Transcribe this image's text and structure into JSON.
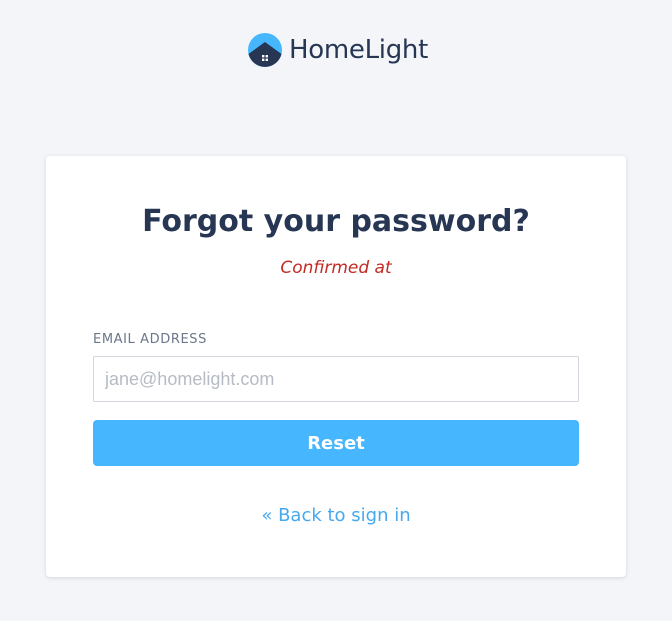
{
  "brand": {
    "name": "HomeLight",
    "logo_icon": "house-icon",
    "colors": {
      "logo_blue": "#46b6ff",
      "logo_navy": "#273653"
    }
  },
  "form": {
    "title": "Forgot your password?",
    "flash_message": "Confirmed at",
    "email_label": "EMAIL ADDRESS",
    "email_placeholder": "jane@homelight.com",
    "email_value": "",
    "submit_label": "Reset",
    "back_link": "« Back to sign in"
  },
  "colors": {
    "background": "#f3f5f9",
    "heading": "#273653",
    "flash_error": "#c22a23",
    "primary_button": "#46b6ff",
    "link": "#46a9ef"
  }
}
